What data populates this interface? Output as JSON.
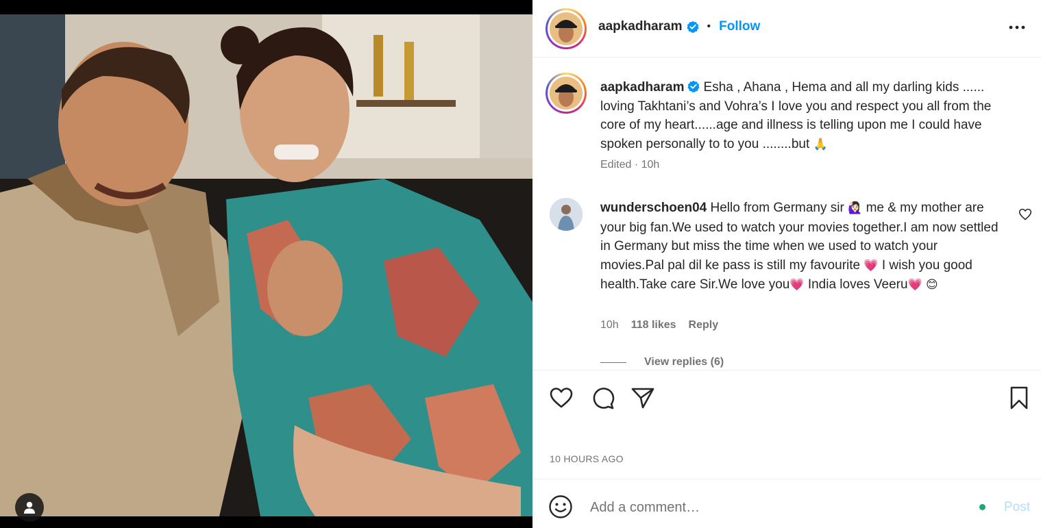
{
  "post": {
    "author": "aapkadharam",
    "follow_label": "Follow",
    "separator": "•",
    "more_icon": "more-horizontal-icon",
    "verified_icon": "verified-badge-icon"
  },
  "caption": {
    "username": "aapkadharam",
    "text": "Esha , Ahana , Hema and all my darling kids ...... loving Takhtani’s and Vohra’s I love you and respect you all from the core of my heart......age and illness is telling upon me I could have spoken personally to to you ........but",
    "emoji": "🙏",
    "meta": "Edited · 10h"
  },
  "comment": {
    "username": "wunderschoen04",
    "text_1": "Hello from Germany sir",
    "emoji_1": "🙋🏻‍♀️",
    "text_2": "me & my mother are your big fan.We used to watch your movies together.I am now settled in Germany but miss the time when we used to watch your movies.Pal pal dil ke pass is still my favourite",
    "emoji_2": "💗",
    "text_3": "I wish you good health.Take care Sir.We love you",
    "emoji_3": "💗",
    "text_4": "India loves Veeru",
    "emoji_4": "💗",
    "emoji_5": "😊",
    "time": "10h",
    "likes": "118 likes",
    "reply": "Reply",
    "view_replies": "View replies (6)"
  },
  "actions": {
    "like_icon": "heart-icon",
    "comment_icon": "comment-icon",
    "share_icon": "send-icon",
    "save_icon": "bookmark-icon"
  },
  "timestamp": "10 HOURS AGO",
  "add_comment": {
    "placeholder": "Add a comment…",
    "post_label": "Post",
    "emoji_icon": "smiley-icon"
  },
  "colors": {
    "accent": "#0095f6",
    "text": "#262626",
    "muted": "#737373",
    "post_disabled": "#b2dffc",
    "online": "#1aa87b"
  }
}
